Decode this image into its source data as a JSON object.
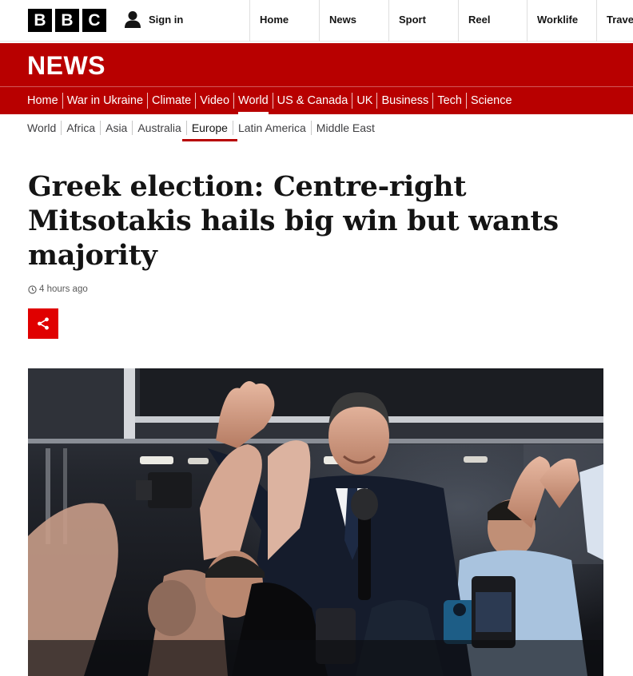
{
  "brand": {
    "letters": [
      "B",
      "B",
      "C"
    ],
    "section": "NEWS"
  },
  "signin": {
    "label": "Sign in",
    "icon": "user-icon"
  },
  "top_nav": [
    "Home",
    "News",
    "Sport",
    "Reel",
    "Worklife",
    "Travel"
  ],
  "primary_nav": {
    "items": [
      "Home",
      "War in Ukraine",
      "Climate",
      "Video",
      "World",
      "US & Canada",
      "UK",
      "Business",
      "Tech",
      "Science"
    ],
    "active": "World"
  },
  "secondary_nav": {
    "items": [
      "World",
      "Africa",
      "Asia",
      "Australia",
      "Europe",
      "Latin America",
      "Middle East"
    ],
    "active": "Europe"
  },
  "article": {
    "headline": "Greek election: Centre-right Mitsotakis hails big win but wants majority",
    "timestamp": "4 hours ago",
    "share_icon": "share-icon"
  },
  "colors": {
    "brand_red": "#b80000",
    "share_red": "#e00000",
    "text": "#141414"
  }
}
